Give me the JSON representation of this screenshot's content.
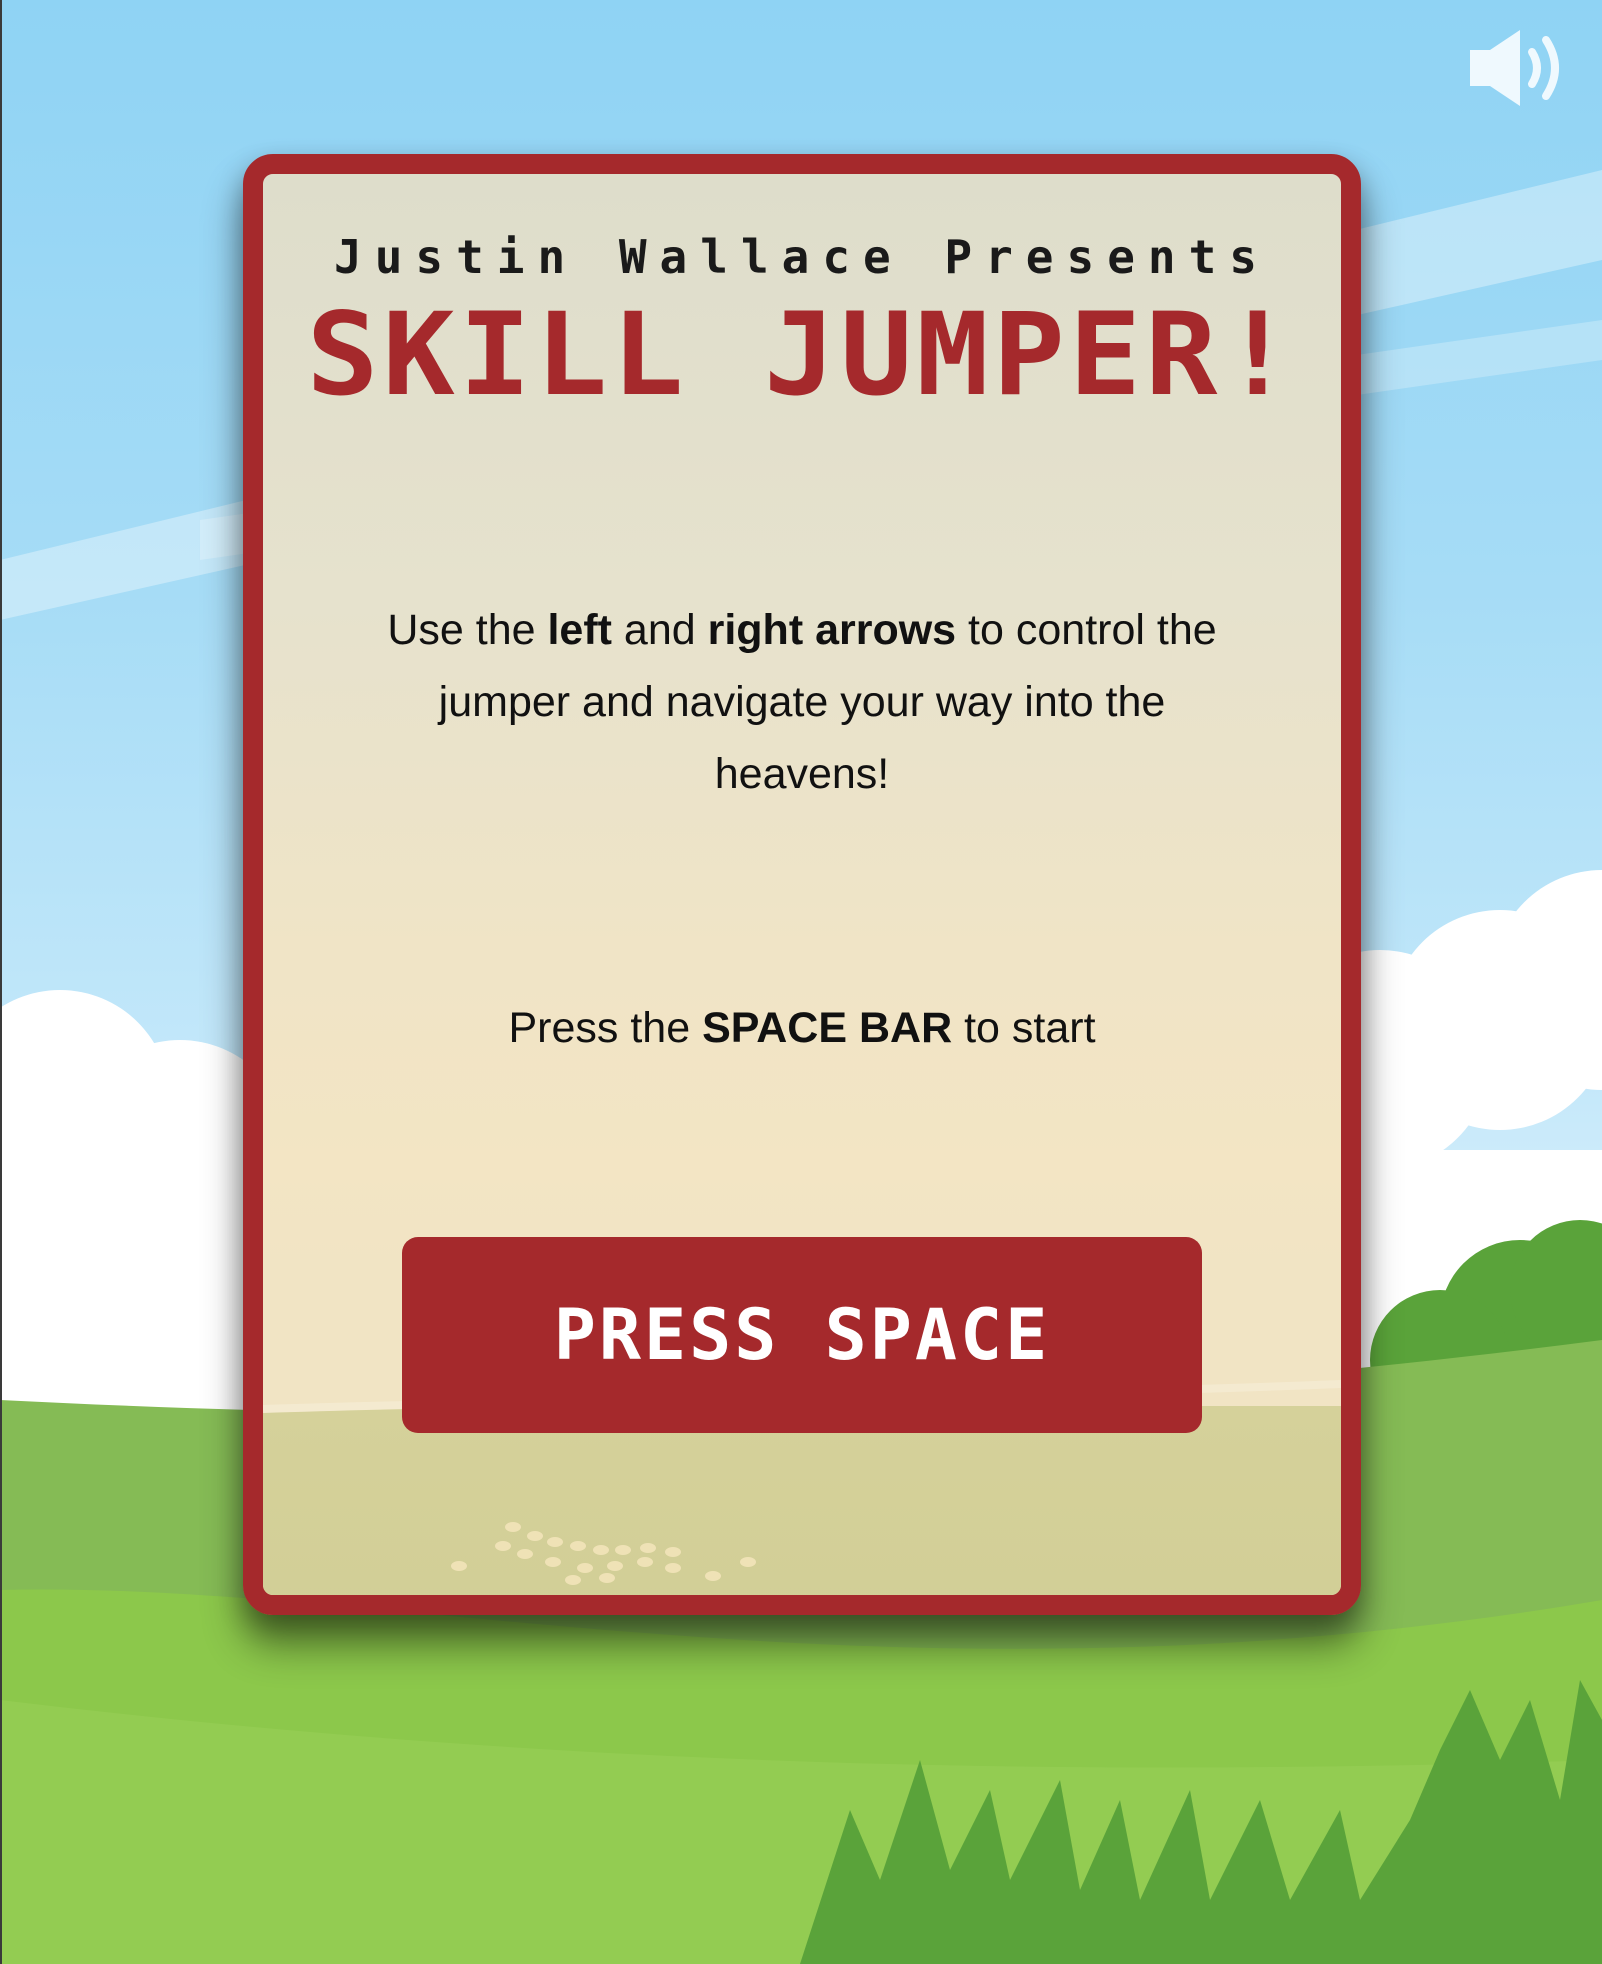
{
  "game": {
    "presenter": "Justin Wallace Presents",
    "title": "SKILL JUMPER!"
  },
  "instructions": {
    "part1": "Use the ",
    "bold1": "left",
    "part2": " and ",
    "bold2": "right arrows",
    "part3": " to control the jumper and navigate your way into the heavens!"
  },
  "start_hint": {
    "prefix": "Press the ",
    "key": "SPACE BAR",
    "suffix": " to start"
  },
  "button": {
    "label": "PRESS SPACE"
  },
  "icons": {
    "sound": "speaker-volume-icon"
  },
  "colors": {
    "accent": "#a5292c",
    "sky": "#8fd3f4",
    "grass": "#8cc84b",
    "card_bg": "#ece3c8"
  }
}
